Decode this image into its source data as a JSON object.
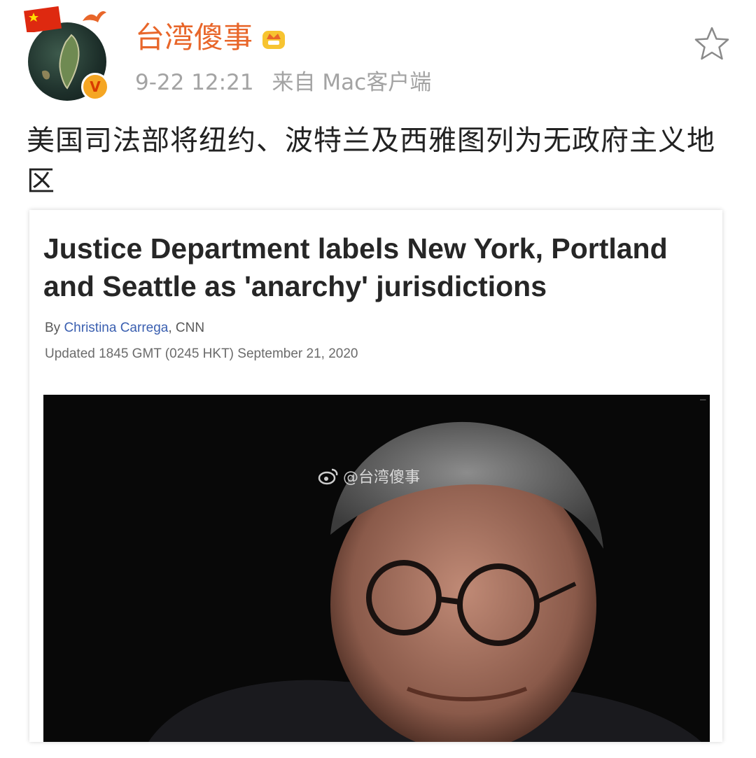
{
  "post": {
    "username": "台湾傻事",
    "timestamp": "9-22 12:21",
    "source": "来自 Mac客户端",
    "text": "美国司法部将纽约、波特兰及西雅图列为无政府主义地区"
  },
  "article": {
    "headline": "Justice Department labels New York, Portland and Seattle as 'anarchy' jurisdictions",
    "byline_prefix": "By ",
    "author": "Christina Carrega",
    "byline_suffix": ", CNN",
    "updated": "Updated 1845 GMT (0245 HKT) September 21, 2020",
    "watermark": "@台湾傻事"
  },
  "icons": {
    "avatar_badge": "verified-badge-icon",
    "crown": "crown-membership-icon",
    "star": "star-icon",
    "weibo_logo": "weibo-logo-icon"
  },
  "colors": {
    "username": "#e8662a",
    "meta": "#a3a3a3",
    "author_link": "#3a5fb0",
    "badge": "#f5a623"
  }
}
